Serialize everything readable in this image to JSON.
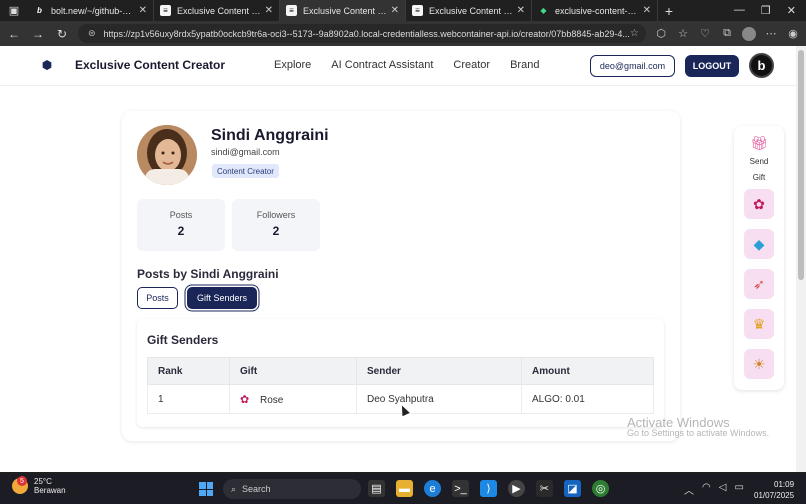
{
  "browser": {
    "tabs": [
      {
        "title": "bolt.new/~/github-evhcvaxz",
        "icon": "bolt-icon",
        "active": false
      },
      {
        "title": "Exclusive Content - Creator",
        "icon": "page-icon",
        "active": false
      },
      {
        "title": "Exclusive Content - Creator",
        "icon": "page-icon",
        "active": true
      },
      {
        "title": "Exclusive Content - Creator",
        "icon": "page-icon",
        "active": false
      },
      {
        "title": "exclusive-content-creator",
        "icon": "netlify-icon",
        "active": false
      }
    ],
    "url": "https://zp1v56uxy8rdx5ypatb0ockcb9tr6a-oci3--5173--9a8902a0.local-credentialless.webcontainer-api.io/creator/07bb8845-ab29-4..."
  },
  "navbar": {
    "brand": "Exclusive Content Creator",
    "links": [
      "Explore",
      "AI Contract Assistant",
      "Creator",
      "Brand"
    ],
    "email_button": "deo@gmail.com",
    "logout_button": "LOGOUT",
    "avatar_letter": "b"
  },
  "profile": {
    "name": "Sindi Anggraini",
    "email": "sindi@gmail.com",
    "role": "Content Creator",
    "stats": [
      {
        "label": "Posts",
        "value": "2"
      },
      {
        "label": "Followers",
        "value": "2"
      }
    ],
    "posts_heading": "Posts by Sindi Anggraini",
    "tabs": [
      "Posts",
      "Gift Senders"
    ],
    "active_tab": "Gift Senders"
  },
  "gift_senders": {
    "title": "Gift Senders",
    "columns": [
      "Rank",
      "Gift",
      "Sender",
      "Amount"
    ],
    "rows": [
      {
        "rank": "1",
        "gift": "Rose",
        "gift_icon": "rose-icon",
        "sender": "Deo Syahputra",
        "amount": "ALGO: 0.01"
      }
    ]
  },
  "send_gift": {
    "label_line1": "Send",
    "label_line2": "Gift",
    "gifts": [
      "rose-icon",
      "diamond-icon",
      "rocket-icon",
      "crown-icon",
      "lion-icon"
    ]
  },
  "watermark": {
    "line1": "Activate Windows",
    "line2": "Go to Settings to activate Windows."
  },
  "taskbar": {
    "weather_temp": "25°C",
    "weather_desc": "Berawan",
    "notification_count": "5",
    "search_placeholder": "Search",
    "time": "01:09",
    "date": "01/07/2025"
  }
}
